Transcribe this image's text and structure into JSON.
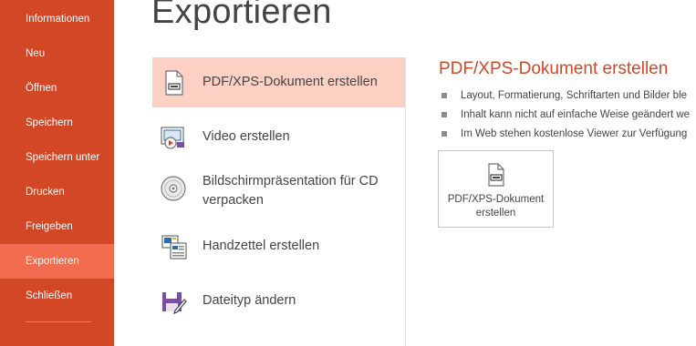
{
  "sidebar": {
    "items": [
      {
        "label": "Informationen"
      },
      {
        "label": "Neu"
      },
      {
        "label": "Öffnen"
      },
      {
        "label": "Speichern"
      },
      {
        "label": "Speichern unter"
      },
      {
        "label": "Drucken"
      },
      {
        "label": "Freigeben"
      },
      {
        "label": "Exportieren",
        "active": true
      },
      {
        "label": "Schließen"
      }
    ],
    "bg_color": "#d24726",
    "active_color": "#f26c4f"
  },
  "page": {
    "title": "Exportieren"
  },
  "options": [
    {
      "label": "PDF/XPS-Dokument erstellen",
      "icon": "pdf-document-icon",
      "selected": true
    },
    {
      "label": "Video erstellen",
      "icon": "video-icon"
    },
    {
      "label": "Bildschirmpräsentation für CD verpacken",
      "icon": "cd-icon"
    },
    {
      "label": "Handzettel erstellen",
      "icon": "handout-icon"
    },
    {
      "label": "Dateityp ändern",
      "icon": "file-type-icon"
    }
  ],
  "detail": {
    "title": "PDF/XPS-Dokument erstellen",
    "bullets": [
      "Layout, Formatierung, Schriftarten und Bilder ble",
      "Inhalt kann nicht auf einfache Weise geändert we",
      "Im Web stehen kostenlose Viewer zur Verfügung"
    ],
    "button_label": "PDF/XPS-Dokument erstellen",
    "accent_color": "#d24726"
  }
}
